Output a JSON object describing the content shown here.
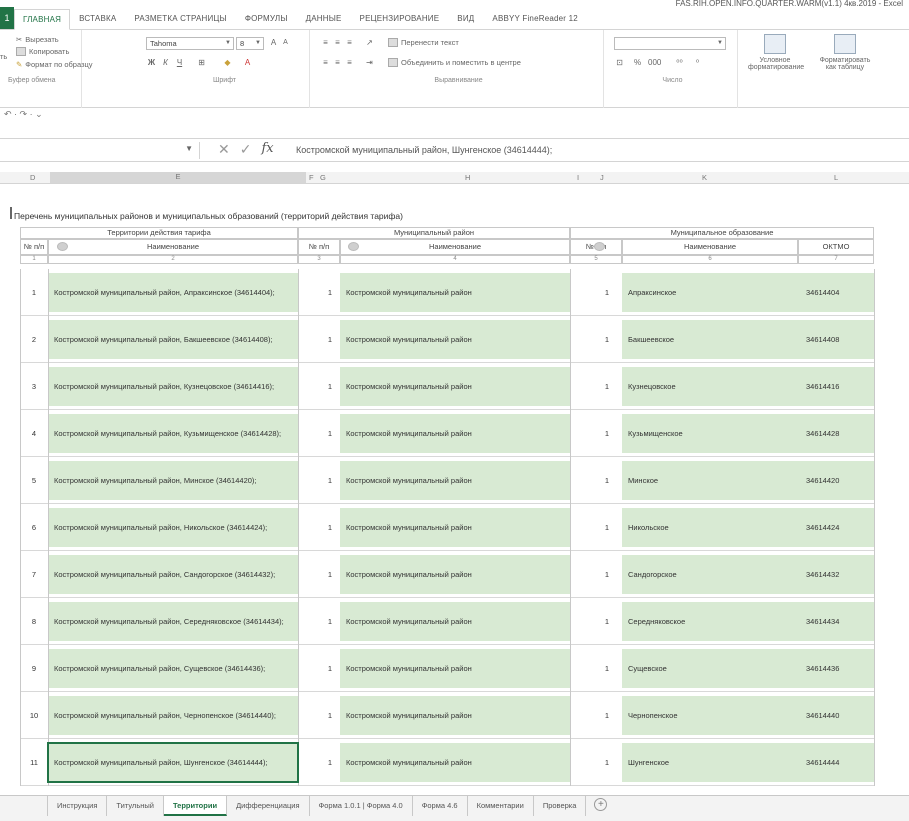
{
  "window": {
    "title": "FAS.RIH.OPEN.INFO.QUARTER.WARM(v1.1) 4кв.2019 - Excel"
  },
  "ribbon": {
    "file_tab": "1",
    "tabs": [
      "ГЛАВНАЯ",
      "ВСТАВКА",
      "РАЗМЕТКА СТРАНИЦЫ",
      "ФОРМУЛЫ",
      "ДАННЫЕ",
      "РЕЦЕНЗИРОВАНИЕ",
      "ВИД",
      "ABBYY FineReader 12"
    ],
    "active_tab": "ГЛАВНАЯ",
    "clipboard": {
      "cut": "Вырезать",
      "copy": "Копировать",
      "format_painter": "Формат по образцу",
      "group": "Буфер обмена",
      "paste_fragment": "ть"
    },
    "font": {
      "name": "Tahoma",
      "size": "8",
      "group": "Шрифт"
    },
    "alignment": {
      "wrap": "Перенести текст",
      "merge": "Объединить и поместить в центре",
      "group": "Выравнивание"
    },
    "number": {
      "group": "Число"
    },
    "styles": {
      "conditional": "Условное форматирование",
      "as_table": "Форматировать как таблицу"
    }
  },
  "formula_bar": {
    "content": "Костромской муниципальный район, Шунгенское (34614444);",
    "fx": "fx"
  },
  "column_headers": [
    "D",
    "E",
    "F",
    "G",
    "H",
    "I",
    "J",
    "K",
    "L"
  ],
  "sheet": {
    "caption": "Перечень муниципальных районов и муниципальных образований (территорий действия тарифа)",
    "groups": {
      "territory": "Территории действия тарифа",
      "district": "Муниципальный район",
      "municipality": "Муниципальное образование"
    },
    "subheaders": {
      "num": "№ п/п",
      "name": "Наименование",
      "oktmo": "ОКТМО"
    },
    "index_row": [
      "1",
      "2",
      "3",
      "4",
      "5",
      "6",
      "7"
    ],
    "rows": [
      {
        "n": "1",
        "territory": "Костромской муниципальный район, Апраксинское (34614404);",
        "d_n": "1",
        "district": "Костромской муниципальный район",
        "m_n": "1",
        "municipality": "Апраксинское",
        "oktmo": "34614404"
      },
      {
        "n": "2",
        "territory": "Костромской муниципальный район, Бакшеевское (34614408);",
        "d_n": "1",
        "district": "Костромской муниципальный район",
        "m_n": "1",
        "municipality": "Бакшеевское",
        "oktmo": "34614408"
      },
      {
        "n": "3",
        "territory": "Костромской муниципальный район, Кузнецовское (34614416);",
        "d_n": "1",
        "district": "Костромской муниципальный район",
        "m_n": "1",
        "municipality": "Кузнецовское",
        "oktmo": "34614416"
      },
      {
        "n": "4",
        "territory": "Костромской муниципальный район, Кузьмищенское (34614428);",
        "d_n": "1",
        "district": "Костромской муниципальный район",
        "m_n": "1",
        "municipality": "Кузьмищенское",
        "oktmo": "34614428"
      },
      {
        "n": "5",
        "territory": "Костромской муниципальный район, Минское (34614420);",
        "d_n": "1",
        "district": "Костромской муниципальный район",
        "m_n": "1",
        "municipality": "Минское",
        "oktmo": "34614420"
      },
      {
        "n": "6",
        "territory": "Костромской муниципальный район, Никольское (34614424);",
        "d_n": "1",
        "district": "Костромской муниципальный район",
        "m_n": "1",
        "municipality": "Никольское",
        "oktmo": "34614424"
      },
      {
        "n": "7",
        "territory": "Костромской муниципальный район, Сандогорское (34614432);",
        "d_n": "1",
        "district": "Костромской муниципальный район",
        "m_n": "1",
        "municipality": "Сандогорское",
        "oktmo": "34614432"
      },
      {
        "n": "8",
        "territory": "Костромской муниципальный район, Середняковское (34614434);",
        "d_n": "1",
        "district": "Костромской муниципальный район",
        "m_n": "1",
        "municipality": "Середняковское",
        "oktmo": "34614434"
      },
      {
        "n": "9",
        "territory": "Костромской муниципальный район, Сущевское (34614436);",
        "d_n": "1",
        "district": "Костромской муниципальный район",
        "m_n": "1",
        "municipality": "Сущевское",
        "oktmo": "34614436"
      },
      {
        "n": "10",
        "territory": "Костромской муниципальный район, Чернопенское (34614440);",
        "d_n": "1",
        "district": "Костромской муниципальный район",
        "m_n": "1",
        "municipality": "Чернопенское",
        "oktmo": "34614440"
      },
      {
        "n": "11",
        "territory": "Костромской муниципальный район, Шунгенское (34614444);",
        "d_n": "1",
        "district": "Костромской муниципальный район",
        "m_n": "1",
        "municipality": "Шунгенское",
        "oktmo": "34614444"
      }
    ]
  },
  "sheet_tabs": [
    "Инструкция",
    "Титульный",
    "Территории",
    "Дифференциация",
    "Форма 1.0.1 | Форма 4.0",
    "Форма 4.6",
    "Комментарии",
    "Проверка"
  ],
  "active_sheet": "Территории",
  "undo_row": "↶ · ↷ · ⌄",
  "colors": {
    "accent": "#217346",
    "cell_green": "#d8ead3"
  }
}
